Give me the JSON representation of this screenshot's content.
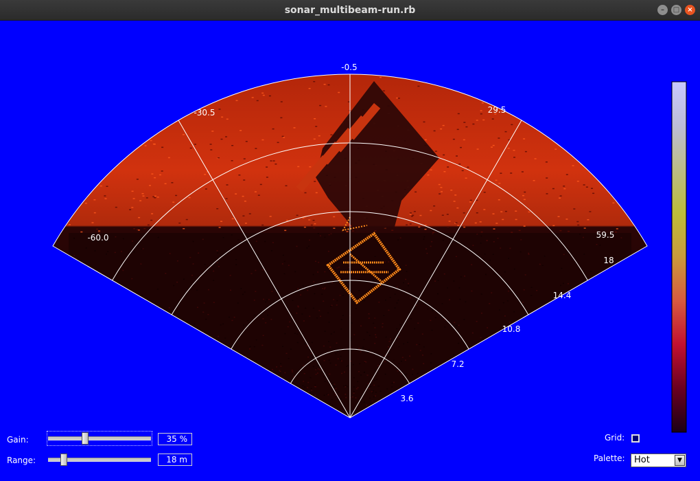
{
  "window": {
    "title": "sonar_multibeam-run.rb"
  },
  "sonar": {
    "angle_labels": {
      "left": "-60.0",
      "left_mid": "-30.5",
      "center": "-0.5",
      "right_mid": "29.5",
      "right": "59.5"
    },
    "range_labels": [
      "3.6",
      "7.2",
      "10.8",
      "14.4",
      "18"
    ],
    "colors": {
      "background": "#0000ff",
      "grid": "#ffffff",
      "target": "#ff8a1a"
    }
  },
  "colorbar": {
    "palette": [
      "#1b0016",
      "#6a0020",
      "#c21030",
      "#d65a40",
      "#c99a3c",
      "#bdbd3a",
      "#bdbd88",
      "#bcbcd8",
      "#c8c8ff"
    ]
  },
  "controls": {
    "gain": {
      "label": "Gain:",
      "value": "35 %",
      "level": 0.35
    },
    "range": {
      "label": "Range:",
      "value": "18 m",
      "level": 0.13
    },
    "grid": {
      "label": "Grid:",
      "checked": false
    },
    "palette": {
      "label": "Palette:",
      "selected": "Hot"
    }
  }
}
